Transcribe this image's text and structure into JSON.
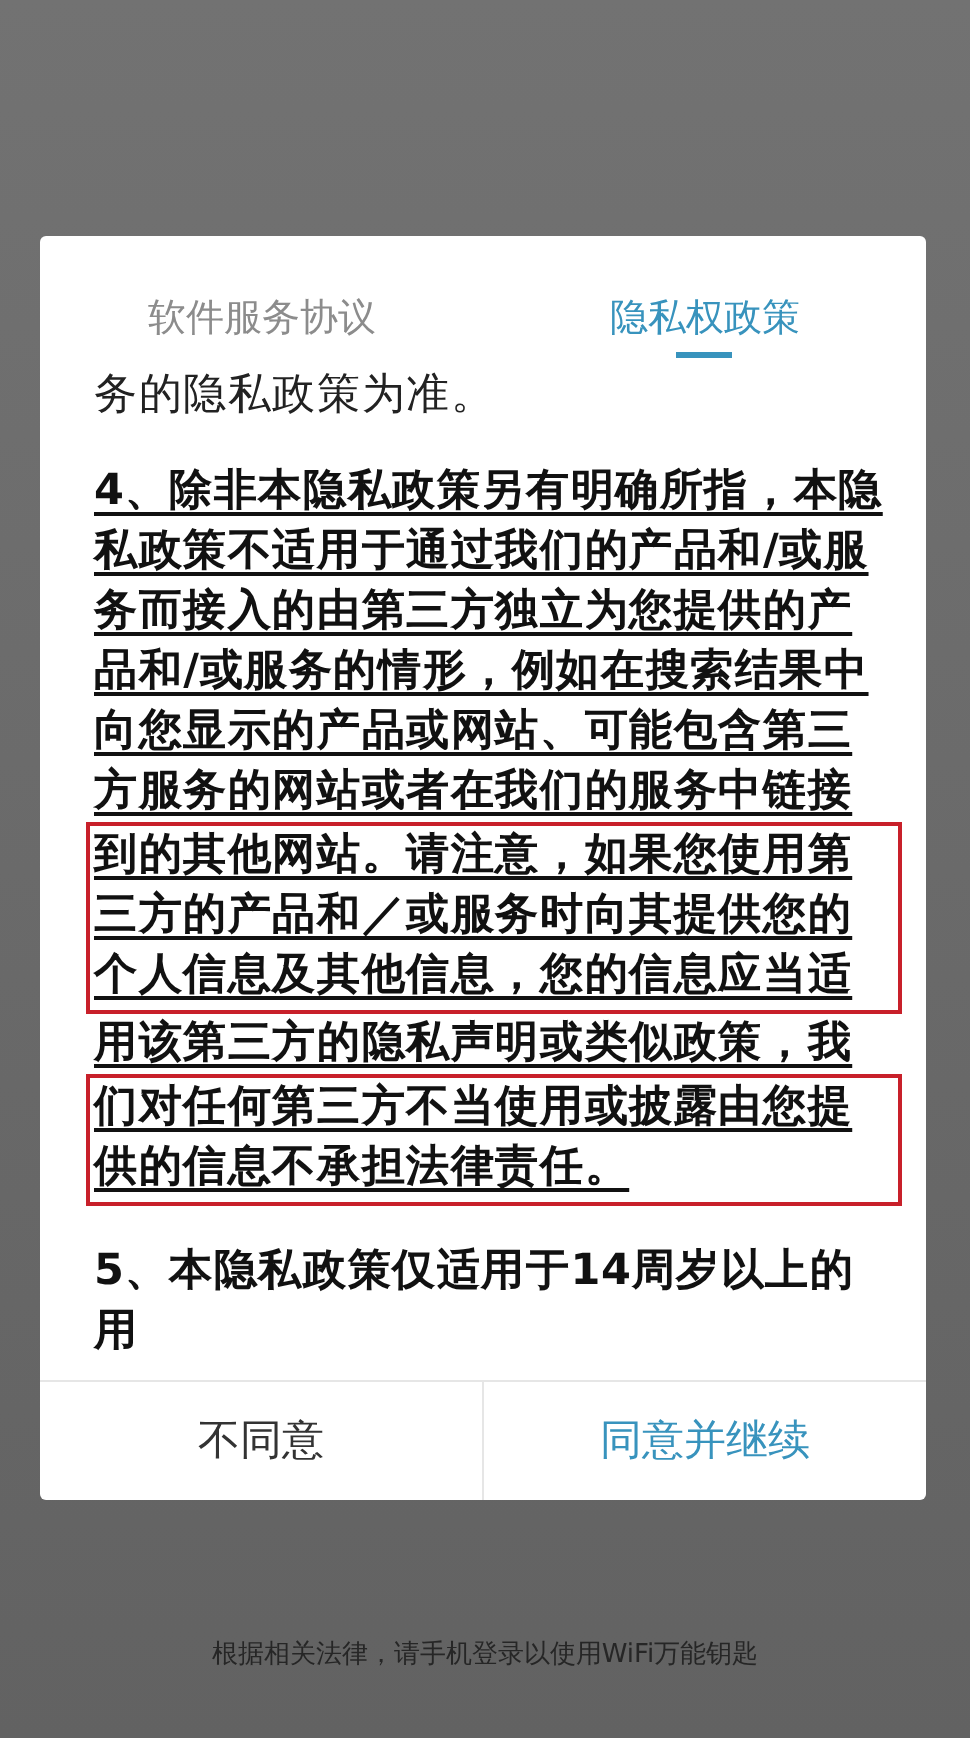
{
  "tabs": [
    {
      "label": "软件服务协议",
      "selected": false
    },
    {
      "label": "隐私权政策",
      "selected": true
    }
  ],
  "paragraphs": [
    {
      "kind": "plain",
      "segments": [
        {
          "text": "务的隐私政策为准。",
          "highlighted": false
        }
      ]
    },
    {
      "kind": "emphasized",
      "segments": [
        {
          "text": "4、除非本隐私政策另有明确所指，本隐私政策不适用于通过我们的产品和/或服务而接入的由第三方独立为您提供的产品和/或服务的情形，例如在搜索结果中向您显示的产品或网站、可能包含第三方服务的网站或者在我们的服务中链接",
          "highlighted": false
        },
        {
          "text": "到的其他网站。请注意，如果您使用第三方的产品和／或服务时向其提供您的个人信息及其他信息，您的信息应当适",
          "highlighted": true
        },
        {
          "text": "用该第三方的隐私声明或类似政策，我",
          "highlighted": false
        },
        {
          "text": "们对任何第三方不当使用或披露由您提供的信息不承担法律责任。",
          "highlighted": true
        }
      ]
    },
    {
      "kind": "heading",
      "segments": [
        {
          "text": "5、本隐私政策仅适用于14周岁以上的用",
          "highlighted": false
        }
      ]
    }
  ],
  "buttons": [
    {
      "label": "不同意",
      "kind": "secondary"
    },
    {
      "label": "同意并继续",
      "kind": "primary"
    }
  ],
  "footer_note": "根据相关法律，请手机登录以使用WiFi万能钥匙"
}
